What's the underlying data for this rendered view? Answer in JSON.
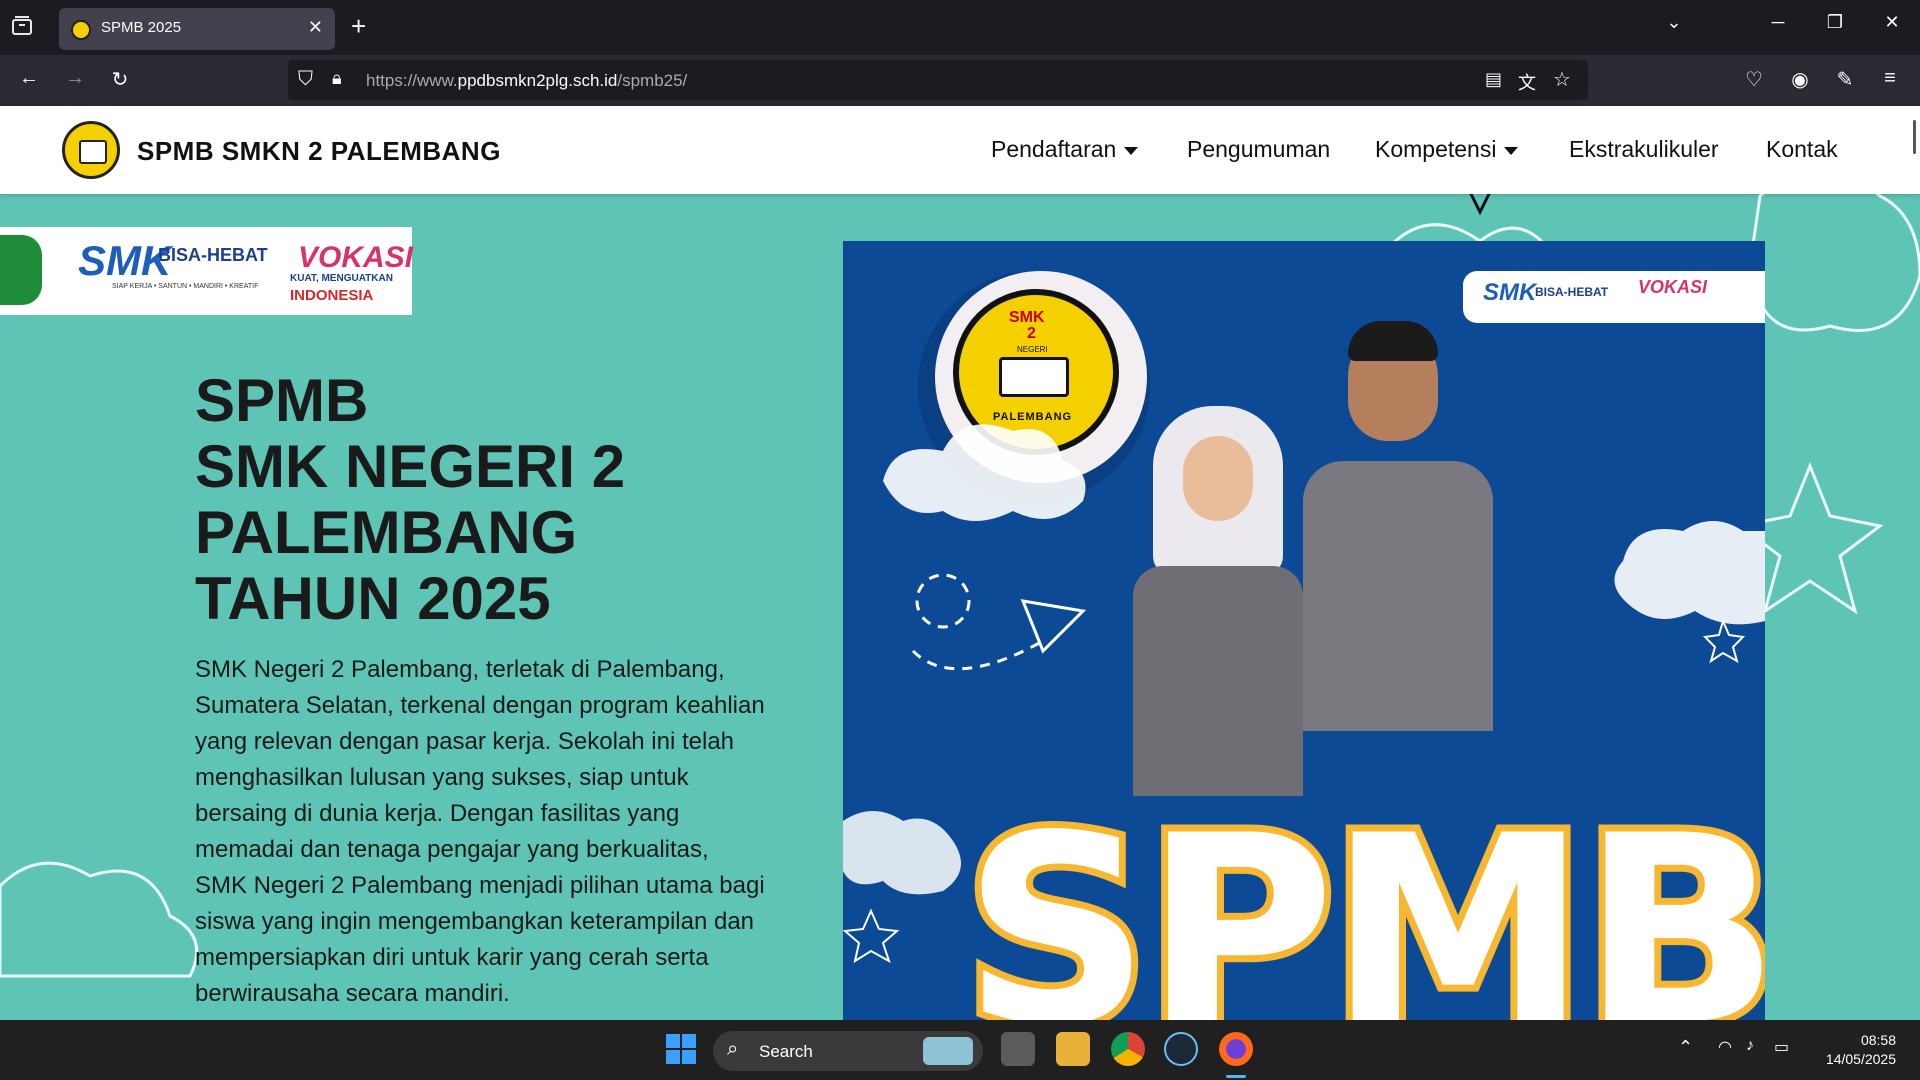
{
  "browser": {
    "tab_title": "SPMB 2025",
    "url_prefix": "https://www.",
    "url_domain": "ppdbsmkn2plg.sch.id",
    "url_path": "/spmb25/"
  },
  "site": {
    "name": "SPMB SMKN 2 PALEMBANG",
    "menu": [
      {
        "label": "Pendaftaran",
        "dropdown": true
      },
      {
        "label": "Pengumuman",
        "dropdown": false
      },
      {
        "label": "Kompetensi",
        "dropdown": true
      },
      {
        "label": "Ekstrakulikuler",
        "dropdown": false
      },
      {
        "label": "Kontak",
        "dropdown": false
      }
    ]
  },
  "banner": {
    "smk_text": "SMK",
    "bisa_hebat": "BISA-HEBAT",
    "tagline": "SIAP KERJA • SANTUN • MANDIRI • KREATIF",
    "vokasi": "VOKASI",
    "vokasi_sub": "KUAT, MENGUATKAN",
    "indonesia": "INDONESIA"
  },
  "hero": {
    "title_lines": [
      "SPMB",
      "SMK NEGERI 2",
      "PALEMBANG",
      "TAHUN 2025"
    ],
    "description": "SMK Negeri 2 Palembang, terletak di Palembang, Sumatera Selatan, terkenal dengan program keahlian yang relevan dengan pasar kerja. Sekolah ini telah menghasilkan lulusan yang sukses, siap untuk bersaing di dunia kerja. Dengan fasilitas yang memadai dan tenaga pengajar yang berkualitas, SMK Negeri 2 Palembang menjadi pilihan utama bagi siswa yang ingin mengembangkan keterampilan dan mempersiapkan diri untuk karir yang cerah serta berwirausaha secara mandiri.",
    "poster_word": "SPMB",
    "emblem_top": "SMK",
    "emblem_num": "2",
    "emblem_ring": "NEGERI",
    "emblem_bottom": "PALEMBANG"
  },
  "taskbar": {
    "search_label": "Search",
    "time": "08:58",
    "date": "14/05/2025"
  },
  "colors": {
    "page_bg": "#5ec4b6",
    "poster_bg": "#0c4a96",
    "accent_yellow": "#f7b731"
  }
}
